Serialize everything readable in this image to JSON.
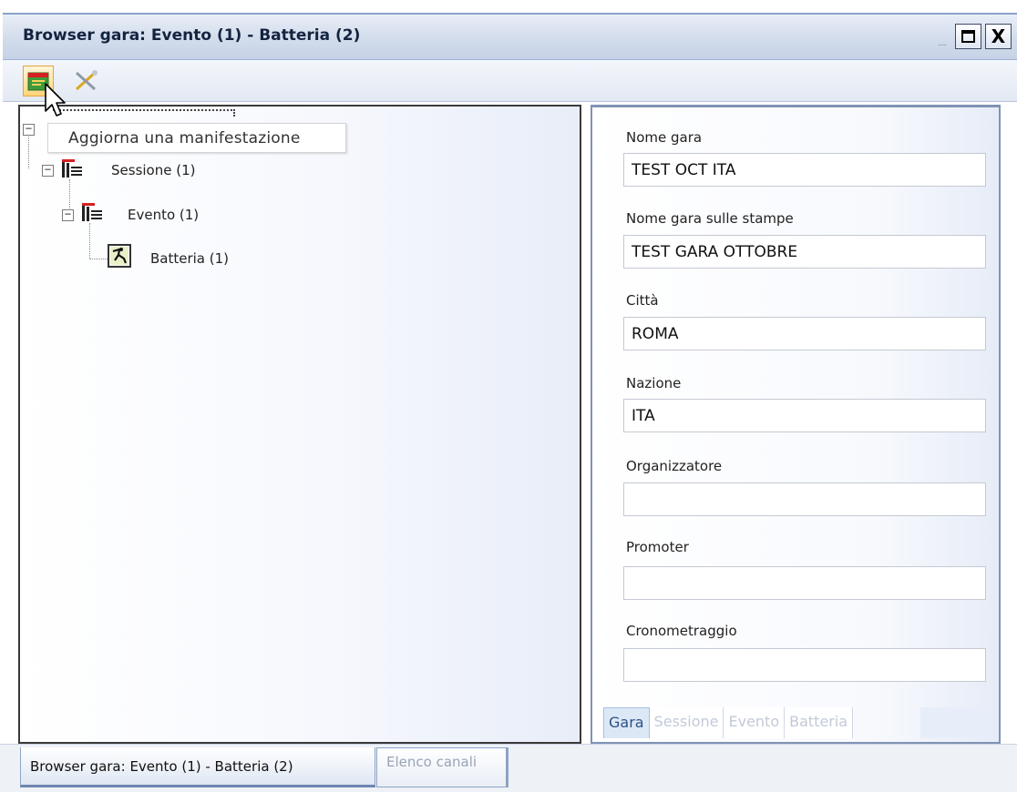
{
  "window": {
    "title": "Browser gara: Evento (1) - Batteria (2)",
    "minimize_glyph": "_",
    "close_glyph": "X"
  },
  "toolbar": {
    "refresh_icon": "refresh-event-icon",
    "tools_icon": "tools-icon"
  },
  "tooltip": "Aggiorna una manifestazione",
  "tree": {
    "nodes": [
      {
        "label": "Sessione (1)",
        "icon": "session-icon",
        "expander": "−"
      },
      {
        "label": "Evento (1)",
        "icon": "event-icon",
        "expander": "−"
      },
      {
        "label": "Batteria (1)",
        "icon": "heat-icon"
      }
    ],
    "root_expander": "−"
  },
  "form": {
    "fields": [
      {
        "label": "Nome gara",
        "value": "TEST OCT ITA"
      },
      {
        "label": "Nome gara sulle stampe",
        "value": "TEST GARA OTTOBRE"
      },
      {
        "label": "Città",
        "value": "ROMA"
      },
      {
        "label": "Nazione",
        "value": "ITA"
      },
      {
        "label": "Organizzatore",
        "value": ""
      },
      {
        "label": "Promoter",
        "value": ""
      },
      {
        "label": "Cronometraggio",
        "value": ""
      }
    ],
    "tabs": [
      "Gara",
      "Sessione",
      "Evento",
      "Batteria"
    ],
    "active_tab": "Gara"
  },
  "document_tabs": [
    {
      "label": "Browser gara: Evento (1) - Batteria (2)",
      "active": true
    },
    {
      "label": "Elenco canali",
      "active": false
    }
  ],
  "colors": {
    "accent_red": "#d42020",
    "tab_active_text": "#2a4f86"
  }
}
